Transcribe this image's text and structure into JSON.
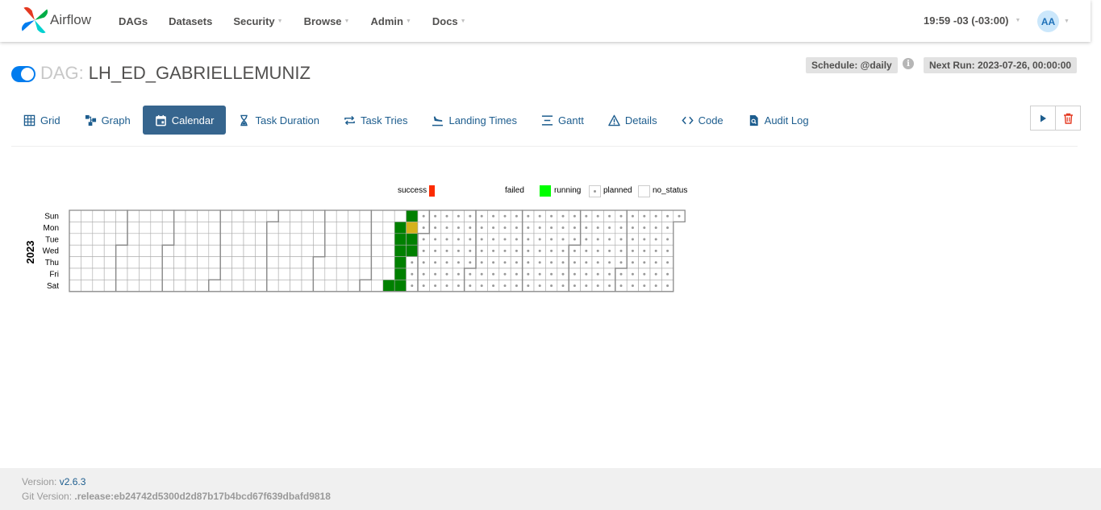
{
  "navbar": {
    "brand": "Airflow",
    "items": [
      {
        "label": "DAGs",
        "dropdown": false
      },
      {
        "label": "Datasets",
        "dropdown": false
      },
      {
        "label": "Security",
        "dropdown": true
      },
      {
        "label": "Browse",
        "dropdown": true
      },
      {
        "label": "Admin",
        "dropdown": true
      },
      {
        "label": "Docs",
        "dropdown": true
      }
    ],
    "clock": "19:59 -03 (-03:00)",
    "user_initials": "AA"
  },
  "dag": {
    "prefix": "DAG:",
    "name": "LH_ED_GABRIELLEMUNIZ",
    "paused": false,
    "schedule": "Schedule: @daily",
    "next_run": "Next Run: 2023-07-26, 00:00:00"
  },
  "tabs": [
    {
      "label": "Grid",
      "icon": "grid-icon"
    },
    {
      "label": "Graph",
      "icon": "graph-icon"
    },
    {
      "label": "Calendar",
      "icon": "calendar-icon",
      "active": true
    },
    {
      "label": "Task Duration",
      "icon": "hourglass-icon"
    },
    {
      "label": "Task Tries",
      "icon": "retry-icon"
    },
    {
      "label": "Landing Times",
      "icon": "landing-icon"
    },
    {
      "label": "Gantt",
      "icon": "gantt-icon"
    },
    {
      "label": "Details",
      "icon": "warning-icon"
    },
    {
      "label": "Code",
      "icon": "code-icon"
    },
    {
      "label": "Audit Log",
      "icon": "audit-log-icon"
    }
  ],
  "actions": [
    {
      "name": "trigger-dag-button",
      "icon": "play-icon"
    },
    {
      "name": "delete-dag-button",
      "icon": "trash-icon"
    }
  ],
  "legend": {
    "success": "success",
    "failed": "failed",
    "running": "running",
    "planned": "planned",
    "no_status": "no_status",
    "gradient": [
      "#008000",
      "#1a8700",
      "#338e00",
      "#4c9500",
      "#669c00",
      "#80a300",
      "#99aa00",
      "#b3b100",
      "#d78b00",
      "#e36b00",
      "#f04b00",
      "#fc2b00"
    ]
  },
  "calendar": {
    "year": "2023",
    "weekdays": [
      "Sun",
      "Mon",
      "Tue",
      "Wed",
      "Thu",
      "Fri",
      "Sat"
    ],
    "start_date": "2023-01-01",
    "end_date": "2023-12-31",
    "runs": [
      {
        "date": "2023-07-15",
        "state": "success"
      },
      {
        "date": "2023-07-17",
        "state": "success"
      },
      {
        "date": "2023-07-18",
        "state": "success"
      },
      {
        "date": "2023-07-19",
        "state": "success"
      },
      {
        "date": "2023-07-20",
        "state": "success"
      },
      {
        "date": "2023-07-21",
        "state": "success"
      },
      {
        "date": "2023-07-22",
        "state": "success"
      },
      {
        "date": "2023-07-23",
        "state": "success"
      },
      {
        "date": "2023-07-24",
        "state": "partial"
      },
      {
        "date": "2023-07-25",
        "state": "success"
      },
      {
        "date": "2023-07-26",
        "state": "success"
      }
    ],
    "planned_from": "2023-07-24",
    "colors": {
      "success": "#008000",
      "partial": "#d4b21c",
      "running": "#00ff00",
      "border": "#aaaaaa",
      "month_border": "#8a8a8a",
      "planned_dot": "#999999"
    }
  },
  "footer": {
    "version_label": "Version:",
    "version": "v2.6.3",
    "git_label": "Git Version:",
    "git_version": ".release:eb24742d5300d2d87b17b4bcd67f639dbafd9818"
  }
}
